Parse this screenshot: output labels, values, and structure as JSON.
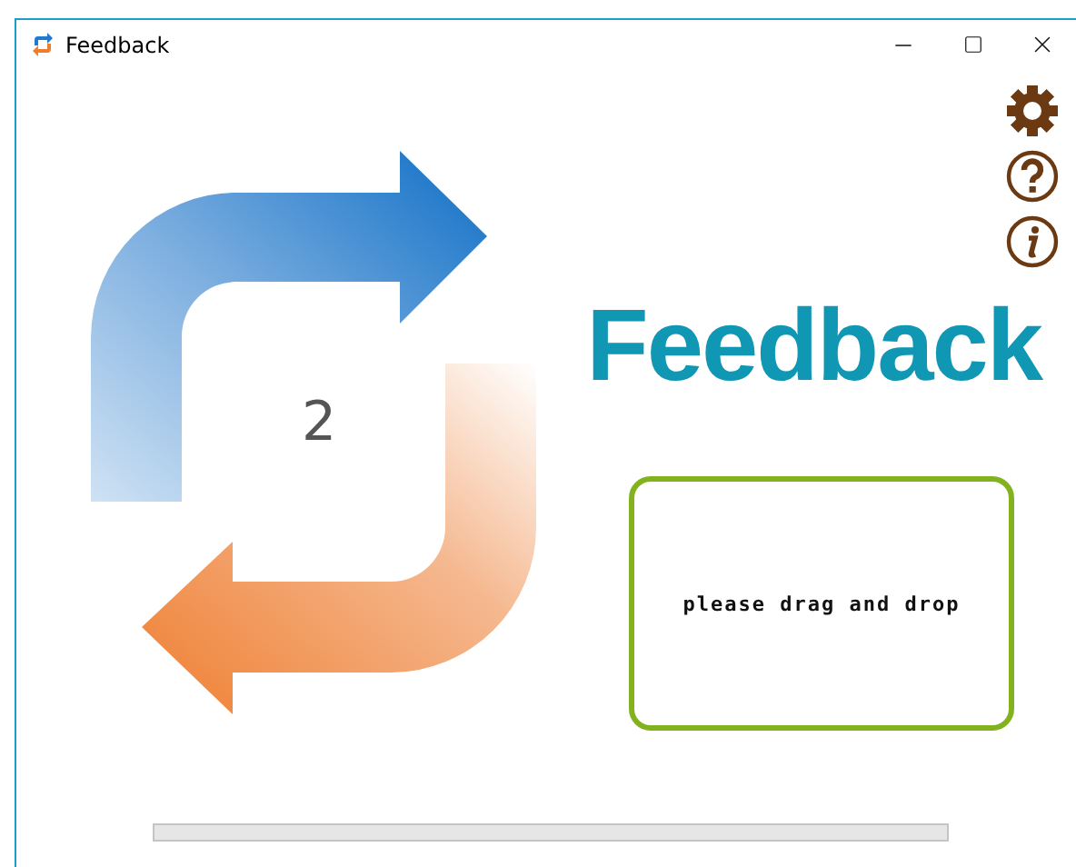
{
  "window": {
    "title": "Feedback"
  },
  "counter": "2",
  "heading": "Feedback",
  "drop_zone": {
    "label": "please drag and drop"
  },
  "progress": {
    "level": 0
  }
}
